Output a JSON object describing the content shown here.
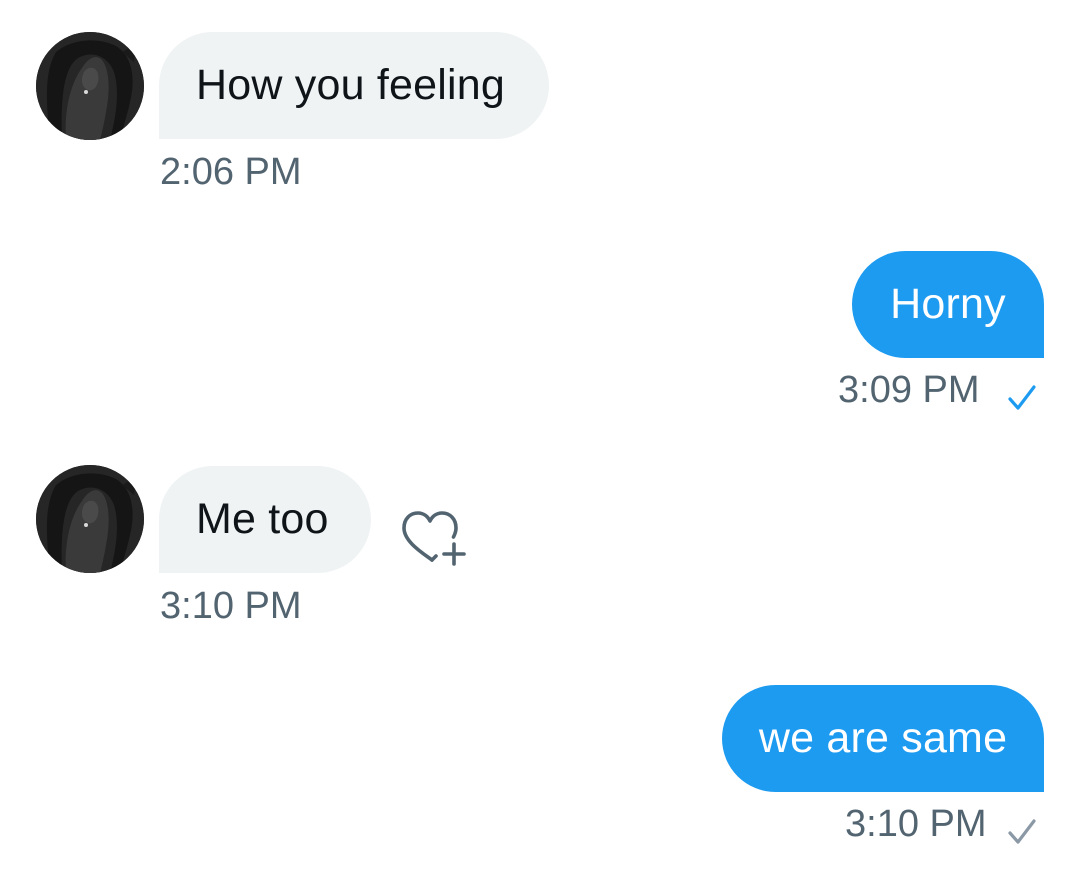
{
  "messages": [
    {
      "direction": "incoming",
      "text": "How you feeling",
      "time": "2:06 PM"
    },
    {
      "direction": "outgoing",
      "text": "Horny",
      "time": "3:09 PM",
      "status": "seen",
      "status_color": "#1d9bf0"
    },
    {
      "direction": "incoming",
      "text": "Me too",
      "time": "3:10 PM",
      "reaction_action": "add-reaction-icon"
    },
    {
      "direction": "outgoing",
      "text": "we are same",
      "time": "3:10 PM",
      "status": "sent",
      "status_color": "#8b98a5"
    }
  ],
  "colors": {
    "incoming_bubble": "#eff3f4",
    "outgoing_bubble": "#1d9bf0",
    "timestamp": "#536471",
    "text_dark": "#0f1419"
  },
  "icons": {
    "avatar": "dark-figure-avatar",
    "reaction": "heart-plus-icon",
    "check": "checkmark-icon"
  }
}
